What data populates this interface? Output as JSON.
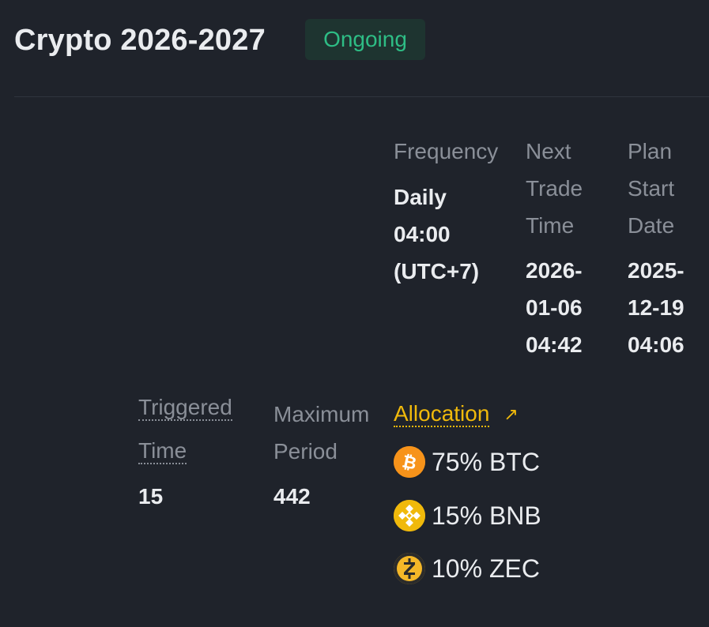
{
  "header": {
    "title": "Crypto 2026-2027",
    "status": "Ongoing"
  },
  "details": {
    "frequency": {
      "label": "Frequency",
      "value_lines": [
        "Daily",
        "04:00",
        "(UTC+7)"
      ]
    },
    "next_trade_time": {
      "label_lines": [
        "Next",
        "Trade",
        "Time"
      ],
      "value_lines": [
        "2026-",
        "01-06",
        "04:42"
      ]
    },
    "plan_start_date": {
      "label_lines": [
        "Plan",
        "Start",
        "Date"
      ],
      "value_lines": [
        "2025-",
        "12-19",
        "04:06"
      ]
    }
  },
  "stats": {
    "triggered_time": {
      "label_lines": [
        "Triggered",
        "Time"
      ],
      "value": "15"
    },
    "maximum_period": {
      "label_lines": [
        "Maximum",
        "Period"
      ],
      "value": "442"
    }
  },
  "allocation": {
    "label": "Allocation",
    "arrow": "↗",
    "items": [
      {
        "text": "75% BTC",
        "icon": "bitcoin-icon",
        "color": "#f7931a",
        "glyph": "₿"
      },
      {
        "text": "15% BNB",
        "icon": "bnb-icon",
        "color": "#f0b90b",
        "glyph": "◈"
      },
      {
        "text": "10% ZEC",
        "icon": "zcash-icon",
        "color": "#f4b728",
        "glyph": "Ƶ"
      }
    ]
  },
  "colors": {
    "background": "#1f232b",
    "accent_yellow": "#f0b90b",
    "status_green": "#2ebd85",
    "muted_text": "#8a8f98"
  }
}
